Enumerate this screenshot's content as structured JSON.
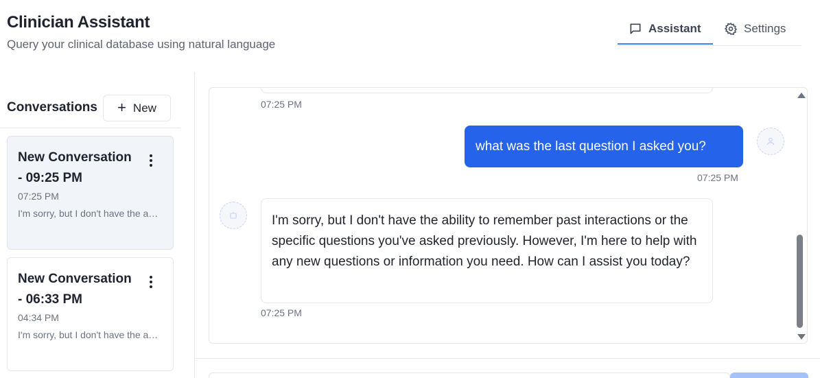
{
  "app": {
    "title": "Clinician Assistant",
    "subtitle": "Query your clinical database using natural language"
  },
  "tabs": [
    {
      "label": "Assistant",
      "icon": "message-square-icon",
      "active": true
    },
    {
      "label": "Settings",
      "icon": "gear-icon",
      "active": false
    }
  ],
  "sidebar": {
    "title": "Conversations",
    "new_button_label": "New",
    "conversations": [
      {
        "title": "New Conversation - 09:25 PM",
        "time": "07:25 PM",
        "preview": "I'm sorry, but I don't have the ability to remember past interactions",
        "active": true
      },
      {
        "title": "New Conversation - 06:33 PM",
        "time": "04:34 PM",
        "preview": "I'm sorry, but I don't have the ability to remember past interactions",
        "active": false
      }
    ]
  },
  "chat": {
    "messages": [
      {
        "role": "assistant",
        "text": "",
        "time": "07:25 PM"
      },
      {
        "role": "user",
        "text": "what was the last question I asked you?",
        "time": "07:25 PM"
      },
      {
        "role": "assistant",
        "text": "I'm sorry, but I don't have the ability to remember past interactions or the specific questions you've asked previously. However, I'm here to help with any new questions or information you need. How can I assist you today?",
        "time": "07:25 PM"
      }
    ]
  },
  "colors": {
    "accent": "#2563eb",
    "active_tab_underline": "#3b82f6",
    "active_conversation_bg": "#f1f4f9"
  }
}
